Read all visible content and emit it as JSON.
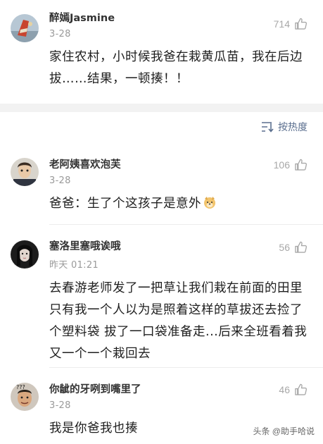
{
  "comments": [
    {
      "username": "醉嫣Jasmine",
      "date": "3-28",
      "likes": "714",
      "text": "家住农村，小时候我爸在栽黄瓜苗，我在后边拔……结果，一顿揍！！"
    },
    {
      "username": "老阿姨喜欢泡芙",
      "date": "3-28",
      "likes": "106",
      "text": "爸爸：生了个这孩子是意外"
    },
    {
      "username": "塞洛里塞哦诶哦",
      "date": "昨天 01:21",
      "likes": "56",
      "text": "去春游老师发了一把草让我们栽在前面的田里 只有我一个人以为是照着这样的草拔还去捡了个塑料袋 拔了一口袋准备走...后来全班看着我又一个一个栽回去"
    },
    {
      "username": "你龇的牙咧到嘴里了",
      "date": "3-28",
      "likes": "46",
      "text": "我是你爸我也揍"
    }
  ],
  "sort": {
    "label": "按热度",
    "icon": "sort-icon"
  },
  "watermark": "头条 @助手哈说",
  "icons": {
    "like": "thumbs-up-icon",
    "emoji": "dog-face-emoji-icon"
  },
  "colors": {
    "sort_accent": "#5b6f8f",
    "muted": "#9a9a9a",
    "band": "#f2f2f2"
  }
}
